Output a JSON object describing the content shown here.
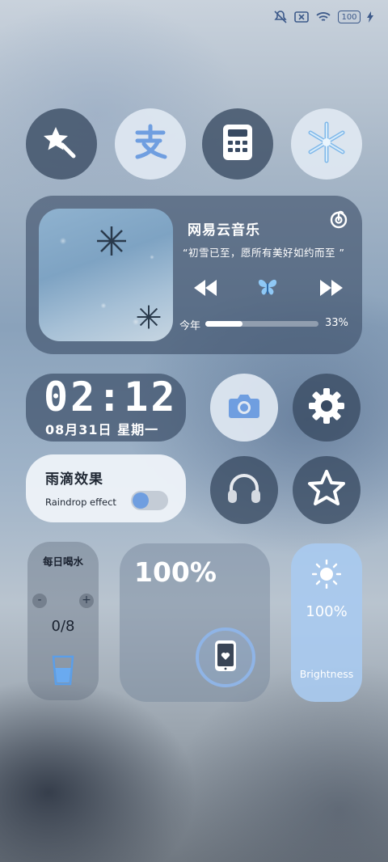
{
  "status_bar": {
    "battery_level": "100",
    "icons": [
      "mute-icon",
      "sim-off-icon",
      "wifi-icon",
      "battery-icon",
      "charging-icon"
    ]
  },
  "app_row": {
    "apps": [
      {
        "name": "star-app",
        "icon": "star-shooting-icon"
      },
      {
        "name": "alipay",
        "icon": "alipay-icon"
      },
      {
        "name": "calculator",
        "icon": "calculator-icon"
      },
      {
        "name": "snowflake-app",
        "icon": "snowflake-icon"
      }
    ]
  },
  "music": {
    "app_name": "网易云音乐",
    "quote": "“初雪已至，愿所有美好如约而至 ”",
    "period_label": "今年",
    "progress": 0.33,
    "progress_text": "33%"
  },
  "clock": {
    "time": "02:12",
    "date": "08月31日 星期一"
  },
  "raindrop": {
    "title": "雨滴效果",
    "subtitle": "Raindrop effect",
    "enabled": true
  },
  "water": {
    "title": "每日喝水",
    "count": "0/8",
    "minus": "-",
    "plus": "+"
  },
  "battery_widget": {
    "percent": "100%"
  },
  "brightness": {
    "percent": "100%",
    "label": "Brightness"
  },
  "colors": {
    "accent": "#6f9ee0",
    "dark_tile": "#384a62",
    "light_tile": "#e0e8f2",
    "brightness_tile": "#a8caf0"
  }
}
